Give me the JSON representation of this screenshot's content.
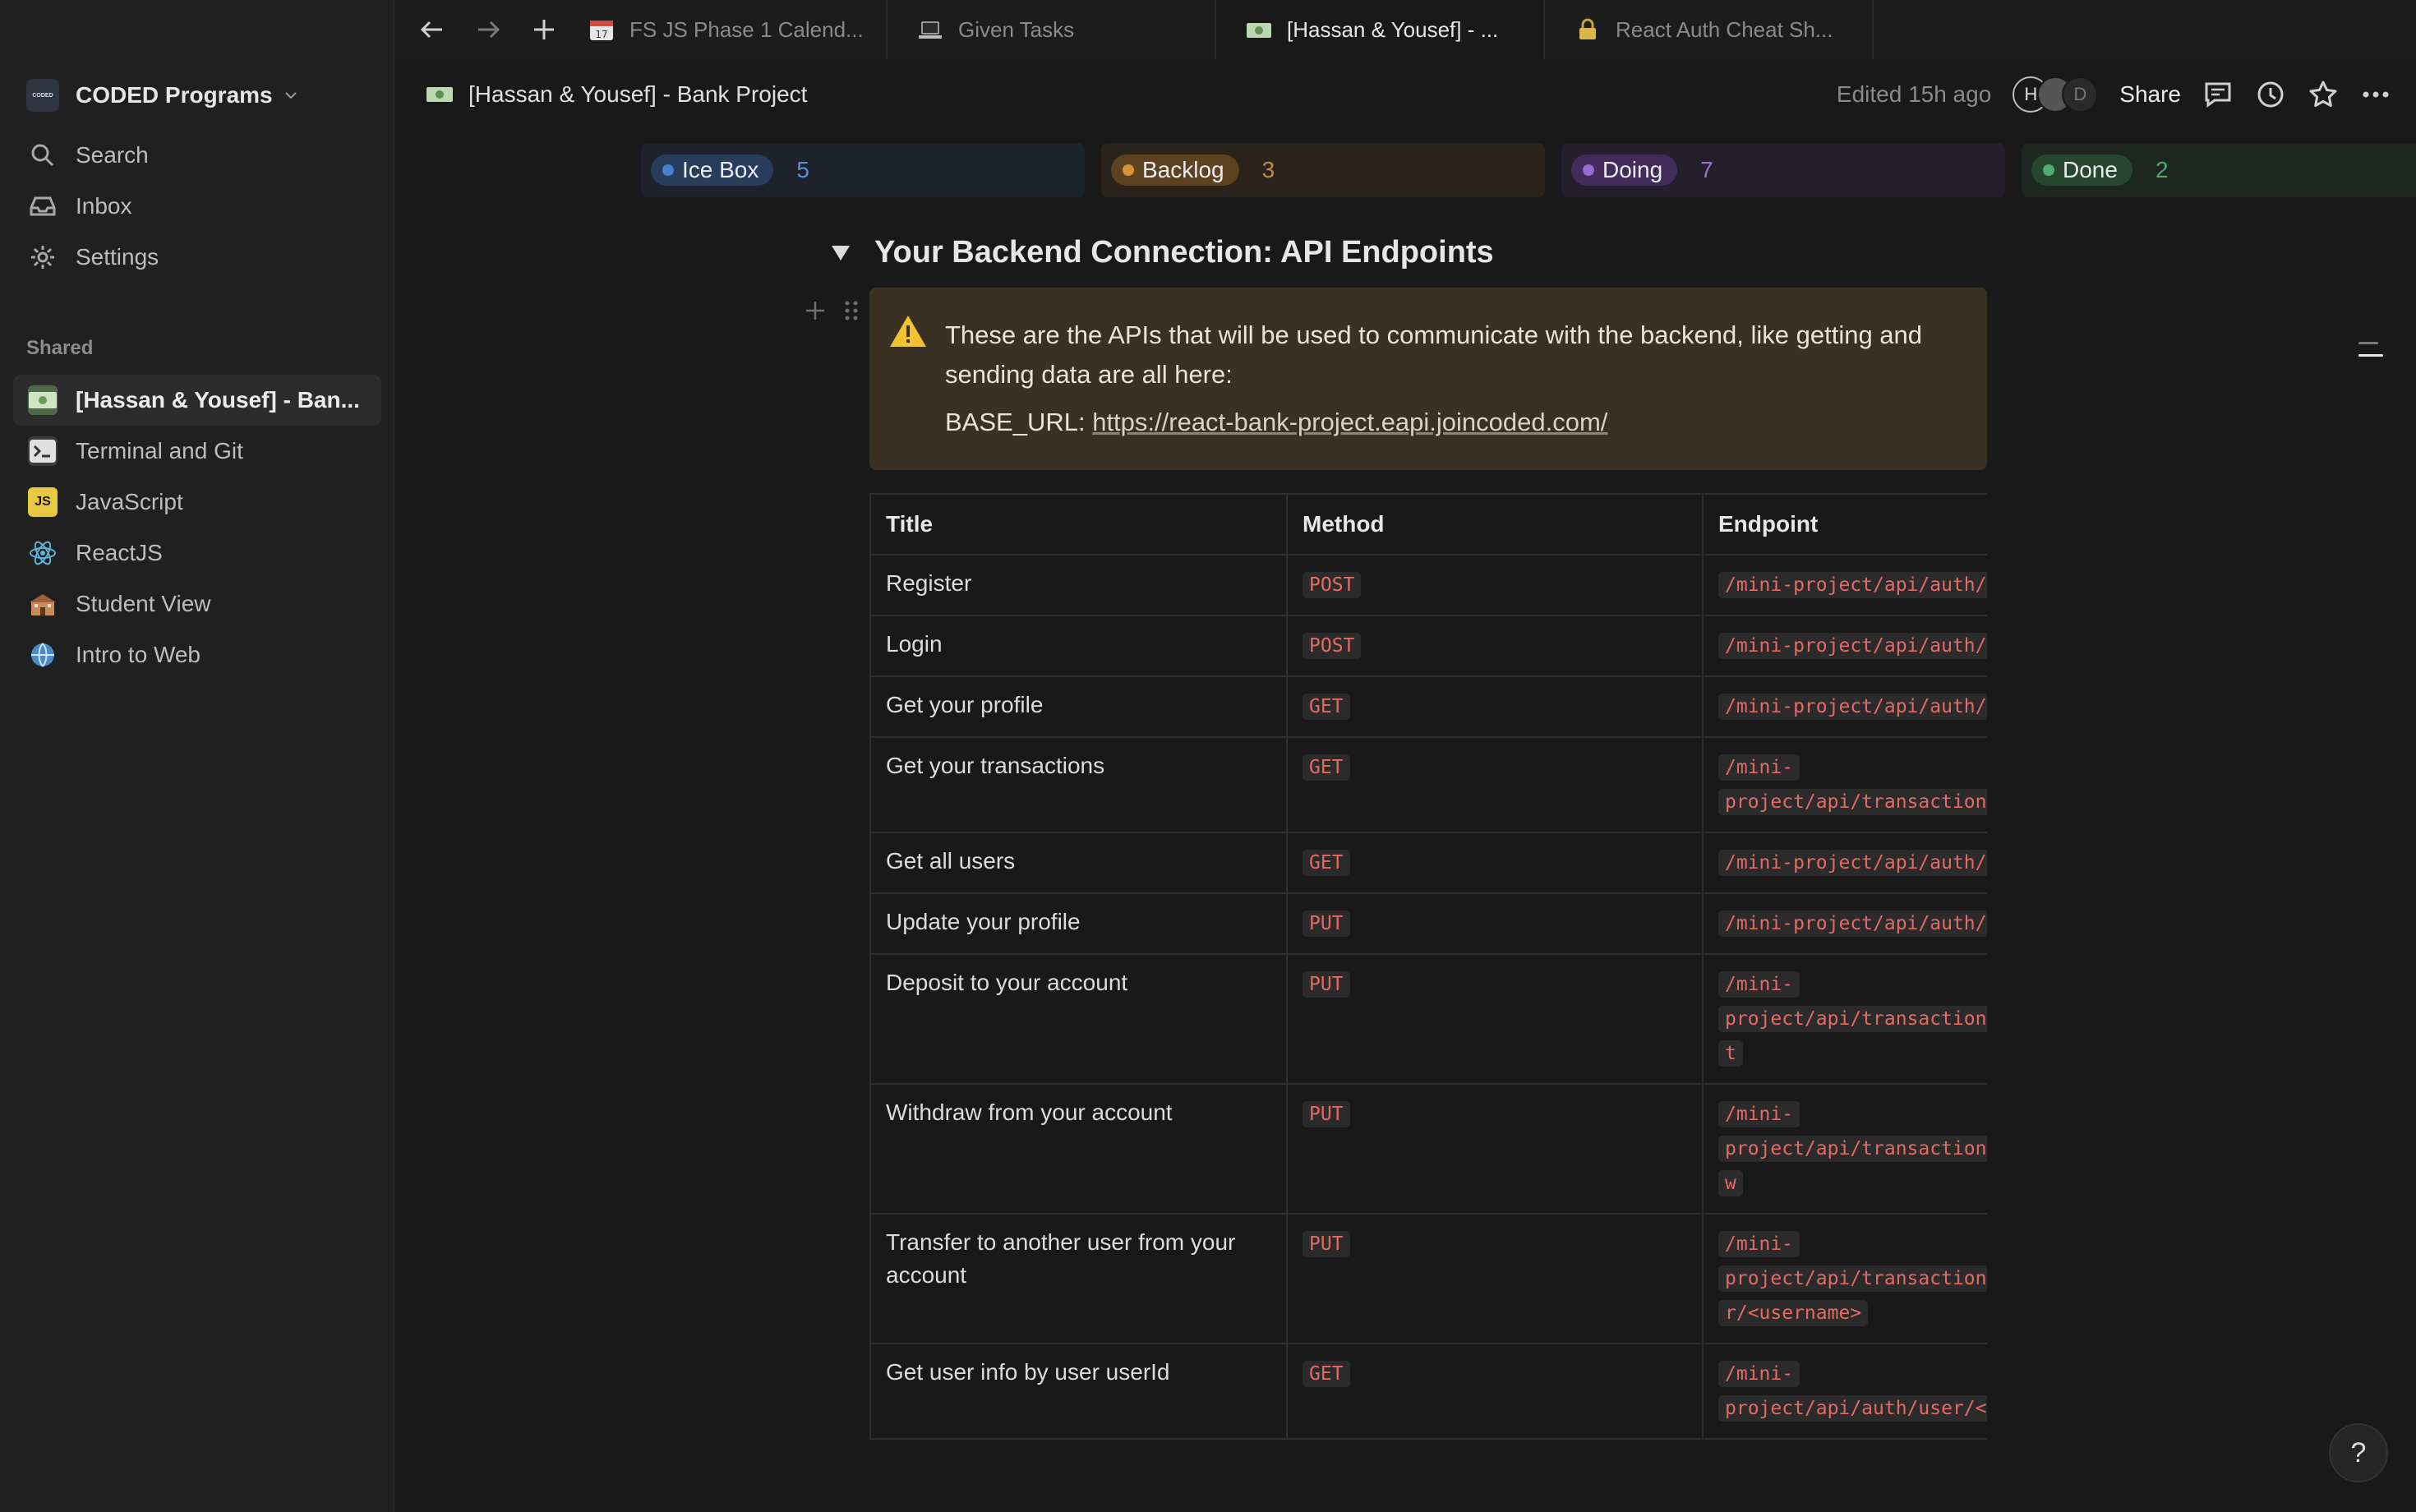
{
  "sidebar": {
    "workspace": {
      "logo_text": "CODED",
      "name": "CODED Programs"
    },
    "nav": [
      {
        "icon": "search-icon",
        "label": "Search"
      },
      {
        "icon": "inbox-icon",
        "label": "Inbox"
      },
      {
        "icon": "gear-icon",
        "label": "Settings"
      }
    ],
    "shared_heading": "Shared",
    "shared": [
      {
        "icon": "money-icon",
        "label": "[Hassan & Yousef] - Ban...",
        "active": true
      },
      {
        "icon": "terminal-icon",
        "label": "Terminal and Git"
      },
      {
        "icon": "js-icon",
        "icon_text": "JS",
        "label": "JavaScript"
      },
      {
        "icon": "react-icon",
        "label": "ReactJS"
      },
      {
        "icon": "school-icon",
        "label": "Student View"
      },
      {
        "icon": "globe-icon",
        "label": "Intro to Web"
      }
    ]
  },
  "tabs": [
    {
      "icon": "calendar-icon",
      "label": "FS JS Phase 1 Calend..."
    },
    {
      "icon": "laptop-icon",
      "label": "Given Tasks"
    },
    {
      "icon": "money-icon",
      "label": "[Hassan & Yousef] - ...",
      "active": true
    },
    {
      "icon": "lock-icon",
      "label": "React Auth Cheat Sh..."
    }
  ],
  "header": {
    "page_title": "[Hassan & Yousef] - Bank Project",
    "edited": "Edited 15h ago",
    "avatar_initial": "H",
    "avatar_third": "D",
    "share": "Share"
  },
  "board": [
    {
      "label": "Ice Box",
      "count": "5",
      "dot": "#4a7fd0",
      "pill_bg": "#283c5c",
      "col_bg": "#1e232b",
      "count_color": "#5a8ed6"
    },
    {
      "label": "Backlog",
      "count": "3",
      "dot": "#d9903a",
      "pill_bg": "#5c4220",
      "col_bg": "#2a231b",
      "count_color": "#c98a3c"
    },
    {
      "label": "Doing",
      "count": "7",
      "dot": "#9a6ad0",
      "pill_bg": "#432c5c",
      "col_bg": "#251f2c",
      "count_color": "#9a75cc"
    },
    {
      "label": "Done",
      "count": "2",
      "dot": "#4fae6c",
      "pill_bg": "#274630",
      "col_bg": "#1d2621",
      "count_color": "#52a86c"
    }
  ],
  "content": {
    "heading": "Your Backend Connection: API Endpoints",
    "callout_line1": "These are the APIs that will be used to communicate with the backend, like getting and sending data are all here:",
    "base_label": "BASE_URL: ",
    "base_url": "https://react-bank-project.eapi.joincoded.com/"
  },
  "table": {
    "headers": [
      "Title",
      "Method",
      "Endpoint"
    ],
    "rows": [
      {
        "title": "Register",
        "method": "POST",
        "endpoint": "/mini-project/api/auth/register"
      },
      {
        "title": "Login",
        "method": "POST",
        "endpoint": "/mini-project/api/auth/login"
      },
      {
        "title": "Get your profile",
        "method": "GET",
        "endpoint": "/mini-project/api/auth/me"
      },
      {
        "title": "Get your transactions",
        "method": "GET",
        "endpoint": "/mini-\nproject/api/transactions/my"
      },
      {
        "title": "Get all users",
        "method": "GET",
        "endpoint": "/mini-project/api/auth/users"
      },
      {
        "title": "Update your profile",
        "method": "PUT",
        "endpoint": "/mini-project/api/auth/profile"
      },
      {
        "title": "Deposit to your account",
        "method": "PUT",
        "endpoint": "/mini-\nproject/api/transactions/deposi\nt"
      },
      {
        "title": "Withdraw from your account",
        "method": "PUT",
        "endpoint": "/mini-\nproject/api/transactions/withdra\nw"
      },
      {
        "title": "Transfer to another user from your account",
        "method": "PUT",
        "endpoint": "/mini-\nproject/api/transactions/transfe\nr/<username>"
      },
      {
        "title": "Get user info by user userId",
        "method": "GET",
        "endpoint": "/mini-\nproject/api/auth/user/<userId>"
      }
    ]
  },
  "help": "?"
}
